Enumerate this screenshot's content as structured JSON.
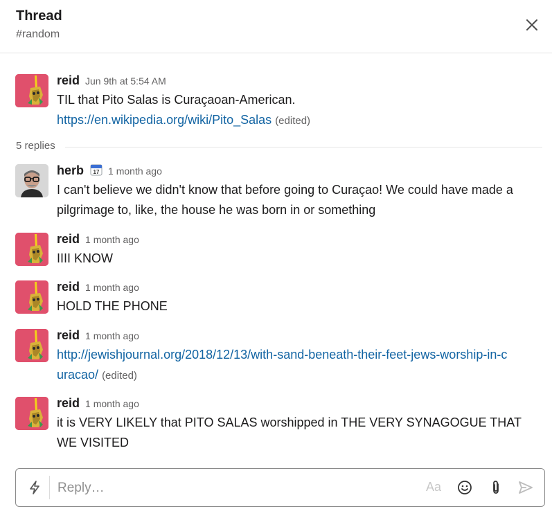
{
  "header": {
    "title": "Thread",
    "channel": "#random"
  },
  "parent": {
    "author": "reid",
    "time": "Jun 9th at 5:54 AM",
    "text": "TIL that Pito Salas is Curaçaoan-American.",
    "link": "https://en.wikipedia.org/wiki/Pito_Salas",
    "edited": "(edited)"
  },
  "replies_label": "5 replies",
  "messages": [
    {
      "author": "herb",
      "time": "1 month ago",
      "status_icon": "calendar-icon",
      "calendar_day": "17",
      "text": "I can't believe we didn't know that before going to Curaçao! We could have made a pilgrimage to, like, the house he was born in or something"
    },
    {
      "author": "reid",
      "time": "1 month ago",
      "text": "IIII KNOW"
    },
    {
      "author": "reid",
      "time": "1 month ago",
      "text": "HOLD THE PHONE"
    },
    {
      "author": "reid",
      "time": "1 month ago",
      "link": "http://jewishjournal.org/2018/12/13/with-sand-beneath-their-feet-jews-worship-in-curacao/",
      "edited": "(edited)"
    },
    {
      "author": "reid",
      "time": "1 month ago",
      "text": "it is VERY LIKELY that PITO SALAS worshipped in THE VERY SYNAGOGUE THAT WE VISITED"
    }
  ],
  "composer": {
    "placeholder": "Reply…",
    "format_label": "Aa",
    "icons": [
      "lightning-icon",
      "emoji-icon",
      "paperclip-icon",
      "send-icon"
    ]
  },
  "colors": {
    "link": "#1264a3",
    "reid_avatar": "#e0506c",
    "text": "#1d1c1d",
    "muted": "#616061"
  }
}
